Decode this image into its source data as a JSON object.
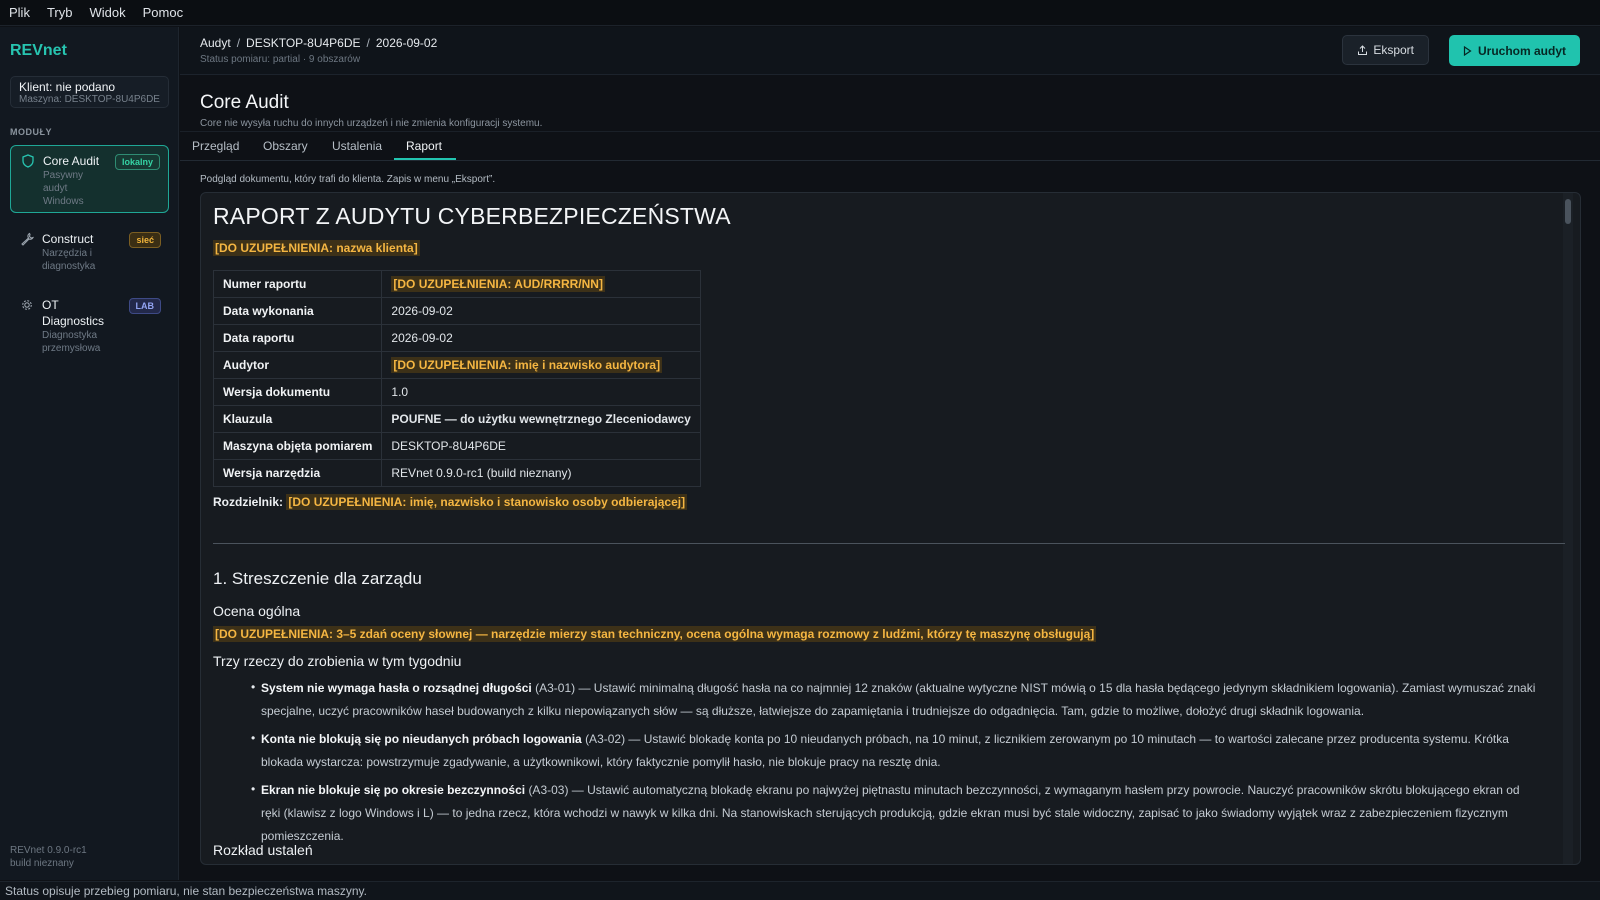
{
  "menu": [
    "Plik",
    "Tryb",
    "Widok",
    "Pomoc"
  ],
  "sidebar": {
    "brand": "REVnet",
    "client": "Klient: nie podano",
    "machine": "Maszyna: DESKTOP-8U4P6DE",
    "modules_label": "MODUŁY",
    "modules": [
      {
        "title": "Core Audit",
        "subtitle": "Pasywny audyt Windows",
        "badge": "lokalny",
        "icon": "shield-icon",
        "active": true
      },
      {
        "title": "Construct",
        "subtitle": "Narzędzia i diagnostyka",
        "badge": "sieć",
        "icon": "wrench-icon",
        "active": false
      },
      {
        "title": "OT Diagnostics",
        "subtitle": "Diagnostyka przemysłowa",
        "badge": "LAB",
        "icon": "gear-icon",
        "active": false
      }
    ],
    "version_line1": "REVnet 0.9.0-rc1",
    "version_line2": "build nieznany"
  },
  "topbar": {
    "breadcrumb": [
      "Audyt",
      "DESKTOP-8U4P6DE",
      "2026-09-02"
    ],
    "measurement_status": "Status pomiaru: partial · 9 obszarów",
    "export_label": "Eksport",
    "run_label": "Uruchom audyt"
  },
  "page": {
    "title": "Core Audit",
    "description": "Core nie wysyła ruchu do innych urządzeń i nie zmienia konfiguracji systemu.",
    "tabs": [
      "Przegląd",
      "Obszary",
      "Ustalenia",
      "Raport"
    ],
    "active_tab": "Raport",
    "doc_hint": "Podgląd dokumentu, który trafi do klienta. Zapis w menu „Eksport”."
  },
  "report": {
    "title": "RAPORT Z AUDYTU CYBERBEZPIECZEŃSTWA",
    "client_placeholder": "[DO UZUPEŁNIENIA: nazwa klienta]",
    "meta": [
      {
        "key": "Numer raportu",
        "value": "[DO UZUPEŁNIENIA: AUD/RRRR/NN]",
        "placeholder": true
      },
      {
        "key": "Data wykonania",
        "value": "2026-09-02"
      },
      {
        "key": "Data raportu",
        "value": "2026-09-02"
      },
      {
        "key": "Audytor",
        "value": "[DO UZUPEŁNIENIA: imię i nazwisko audytora]",
        "placeholder": true
      },
      {
        "key": "Wersja dokumentu",
        "value": "1.0"
      },
      {
        "key": "Klauzula",
        "value": "POUFNE — do użytku wewnętrznego Zleceniodawcy",
        "bold": true
      },
      {
        "key": "Maszyna objęta pomiarem",
        "value": "DESKTOP-8U4P6DE"
      },
      {
        "key": "Wersja narzędzia",
        "value": "REVnet 0.9.0-rc1 (build nieznany)"
      }
    ],
    "distribution_label": "Rozdzielnik:",
    "distribution_value": "[DO UZUPEŁNIENIA: imię, nazwisko i stanowisko osoby odbierającej]",
    "section1": "1. Streszczenie dla zarządu",
    "assessment_heading": "Ocena ogólna",
    "assessment_placeholder": "[DO UZUPEŁNIENIA: 3–5 zdań oceny słownej — narzędzie mierzy stan techniczny, ocena ogólna wymaga rozmowy z ludźmi, którzy tę maszynę obsługują]",
    "todo_heading": "Trzy rzeczy do zrobienia w tym tygodniu",
    "todos": [
      {
        "title": "System nie wymaga hasła o rozsądnej długości",
        "code": "(A3-01)",
        "text": "— Ustawić minimalną długość hasła na co najmniej 12 znaków (aktualne wytyczne NIST mówią o 15 dla hasła będącego jedynym składnikiem logowania). Zamiast wymuszać znaki specjalne, uczyć pracowników haseł budowanych z kilku niepowiązanych słów — są dłuższe, łatwiejsze do zapamiętania i trudniejsze do odgadnięcia. Tam, gdzie to możliwe, dołożyć drugi składnik logowania."
      },
      {
        "title": "Konta nie blokują się po nieudanych próbach logowania",
        "code": "(A3-02)",
        "text": "— Ustawić blokadę konta po 10 nieudanych próbach, na 10 minut, z licznikiem zerowanym po 10 minutach — to wartości zalecane przez producenta systemu. Krótka blokada wystarcza: powstrzymuje zgadywanie, a użytkownikowi, który faktycznie pomylił hasło, nie blokuje pracy na resztę dnia."
      },
      {
        "title": "Ekran nie blokuje się po okresie bezczynności",
        "code": "(A3-03)",
        "text": "— Ustawić automatyczną blokadę ekranu po najwyżej piętnastu minutach bezczynności, z wymaganym hasłem przy powrocie. Nauczyć pracowników skrótu blokującego ekran od ręki (klawisz z logo Windows i L) — to jedna rzecz, która wchodzi w nawyk w kilka dni. Na stanowiskach sterujących produkcją, gdzie ekran musi być stale widoczny, zapisać to jako świadomy wyjątek wraz z zabezpieczeniem fizycznym pomieszczenia."
      }
    ],
    "breakdown_heading": "Rozkład ustaleń"
  },
  "statusbar": "Status opisuje przebieg pomiaru, nie stan bezpieczeństwa maszyny."
}
